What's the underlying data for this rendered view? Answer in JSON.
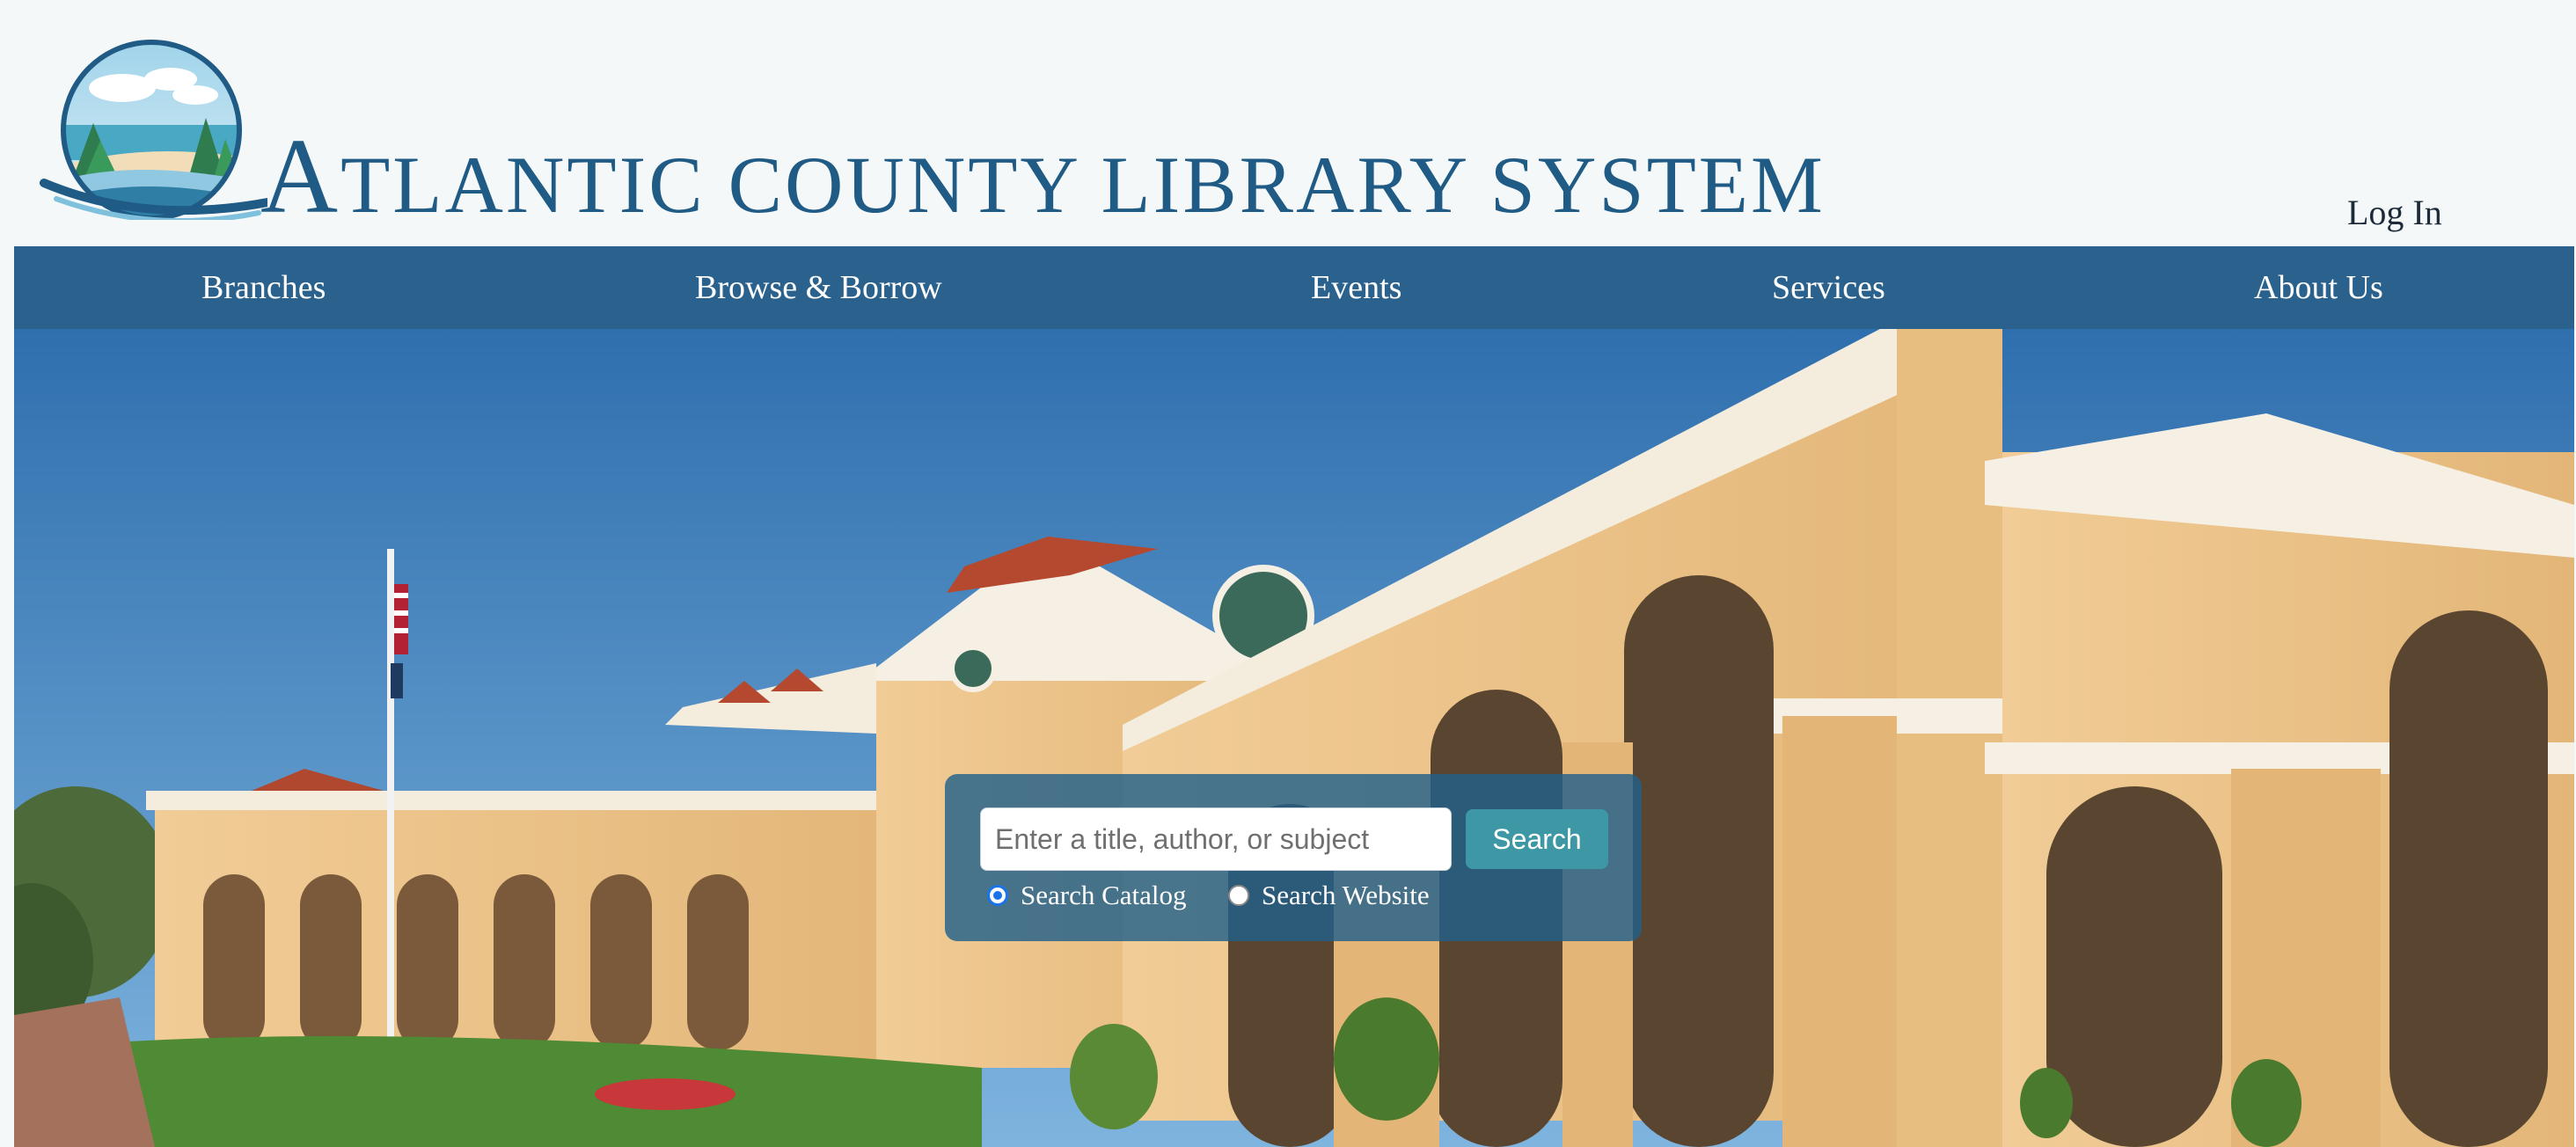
{
  "header": {
    "logo_text_initial": "A",
    "logo_text_rest": "TLANTIC COUNTY LIBRARY SYSTEM",
    "login_label": "Log In"
  },
  "nav": {
    "items": [
      {
        "label": "Branches"
      },
      {
        "label": "Browse & Borrow"
      },
      {
        "label": "Events"
      },
      {
        "label": "Services"
      },
      {
        "label": "About Us"
      }
    ]
  },
  "search": {
    "placeholder": "Enter a title, author, or subject",
    "value": "",
    "button_label": "Search",
    "options": [
      {
        "label": "Search Catalog",
        "selected": true
      },
      {
        "label": "Search Website",
        "selected": false
      }
    ]
  },
  "colors": {
    "brand_blue": "#2b628d",
    "logo_text": "#1f5b85",
    "search_button": "#3e97a4",
    "page_background": "#f4f8f9"
  }
}
